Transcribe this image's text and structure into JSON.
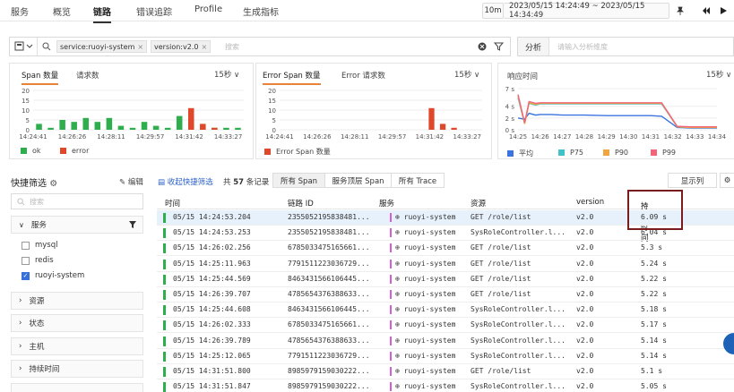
{
  "topnav": {
    "tabs": [
      "服务",
      "概览",
      "链路",
      "错误追踪",
      "Profile",
      "生成指标"
    ],
    "active_tab": "链路",
    "time_range_short": "10m",
    "time_range": "2023/05/15 14:24:49 ~ 2023/05/15 14:34:49"
  },
  "filter": {
    "chips": [
      "service:ruoyi-system",
      "version:v2.0"
    ],
    "placeholder": "搜索",
    "analysis_label": "分析",
    "analysis_placeholder": "请输入分析维度"
  },
  "panels": {
    "span": {
      "tabs": [
        "Span 数量",
        "请求数"
      ],
      "interval": "15秒 ∨",
      "legend": [
        {
          "label": "ok",
          "color": "#2eae4c"
        },
        {
          "label": "error",
          "color": "#e0482b"
        }
      ]
    },
    "error": {
      "tabs": [
        "Error Span 数量",
        "Error 请求数"
      ],
      "interval": "15秒 ∨",
      "legend": [
        {
          "label": "Error Span 数量",
          "color": "#e0482b"
        }
      ]
    },
    "latency": {
      "title": "响应时间",
      "interval": "15秒 ∨",
      "legend": [
        {
          "label": "平均",
          "color": "#3b73e0"
        },
        {
          "label": "P75",
          "color": "#41c2c9"
        },
        {
          "label": "P90",
          "color": "#f0a63f"
        },
        {
          "label": "P99",
          "color": "#f0657a"
        }
      ]
    }
  },
  "chart_data": [
    {
      "type": "bar",
      "title": "Span 数量",
      "ylim": [
        0,
        20
      ],
      "yticks": [
        "20",
        "15",
        "10",
        "5",
        "0"
      ],
      "xticks": [
        "14:24:41",
        "14:26:26",
        "14:28:11",
        "14:29:57",
        "14:31:42",
        "14:33:27"
      ],
      "series": [
        {
          "name": "ok",
          "values": [
            3,
            1,
            5,
            4,
            6,
            4,
            6,
            2,
            1,
            4,
            2,
            1,
            7,
            3,
            1,
            1,
            1,
            1
          ]
        },
        {
          "name": "error",
          "values": [
            0,
            0,
            0,
            0,
            0,
            0,
            0,
            0,
            0,
            0,
            0,
            0,
            0,
            11,
            3,
            1,
            0,
            0
          ]
        }
      ]
    },
    {
      "type": "bar",
      "title": "Error Span 数量",
      "ylim": [
        0,
        20
      ],
      "yticks": [
        "20",
        "15",
        "10",
        "5",
        "0"
      ],
      "xticks": [
        "14:24:41",
        "14:26:26",
        "14:28:11",
        "14:29:57",
        "14:31:42",
        "14:33:27"
      ],
      "series": [
        {
          "name": "Error Span 数量",
          "values": [
            0,
            0,
            0,
            0,
            0,
            0,
            0,
            0,
            0,
            0,
            0,
            0,
            0,
            11,
            3,
            1,
            0,
            0
          ]
        }
      ]
    },
    {
      "type": "line",
      "title": "响应时间",
      "ylim": [
        0,
        7
      ],
      "yticks": [
        "7 s",
        "4 s",
        "2 s",
        "0 s"
      ],
      "xticks": [
        "14:25",
        "14:26",
        "14:27",
        "14:28",
        "14:29",
        "14:30",
        "14:31",
        "14:32",
        "14:33",
        "14:34"
      ],
      "x": [
        0,
        0.3,
        0.5,
        0.8,
        1.0,
        1.5,
        2,
        3,
        4,
        5,
        6,
        6.5,
        7.2,
        7.8,
        8.5,
        9
      ],
      "series": [
        {
          "name": "平均",
          "values": [
            2.0,
            1.8,
            2.8,
            2.5,
            2.6,
            2.6,
            2.5,
            2.5,
            2.4,
            2.4,
            2.4,
            2.3,
            0.4,
            0.3,
            0.3,
            0.3
          ]
        },
        {
          "name": "P75",
          "values": [
            5.5,
            1.0,
            4.5,
            4.2,
            4.4,
            4.4,
            4.4,
            4.4,
            4.4,
            4.4,
            4.4,
            4.4,
            0.5,
            0.4,
            0.4,
            0.4
          ]
        },
        {
          "name": "P90",
          "values": [
            5.8,
            1.0,
            4.6,
            4.3,
            4.5,
            4.5,
            4.5,
            4.5,
            4.5,
            4.5,
            4.5,
            4.5,
            0.5,
            0.4,
            0.4,
            0.4
          ]
        },
        {
          "name": "P99",
          "values": [
            6.0,
            1.2,
            4.8,
            4.5,
            4.6,
            4.6,
            4.6,
            4.6,
            4.6,
            4.6,
            4.6,
            4.6,
            0.6,
            0.5,
            0.5,
            0.5
          ]
        }
      ]
    }
  ],
  "quickfilter": {
    "title": "快捷筛选",
    "edit": "编辑",
    "search_placeholder": "搜索",
    "service_group": "服务",
    "service_items": [
      {
        "label": "mysql",
        "checked": false
      },
      {
        "label": "redis",
        "checked": false
      },
      {
        "label": "ruoyi-system",
        "checked": true
      }
    ],
    "groups": [
      "资源",
      "状态",
      "主机",
      "持续时间"
    ]
  },
  "toolbar": {
    "collect": "收起快捷筛选",
    "count_prefix": "共",
    "count": "57",
    "count_suffix": "条记录",
    "views": [
      "所有 Span",
      "服务顶层 Span",
      "所有 Trace"
    ],
    "display_cols": "显示列"
  },
  "table": {
    "headers": [
      "时间",
      "链路 ID",
      "服务",
      "资源",
      "version",
      "持续时间"
    ],
    "rows": [
      {
        "time": "05/15 14:24:53.204",
        "trace": "2355052195838481...",
        "service": "ruoyi-system",
        "resource": "GET /role/list",
        "version": "v2.0",
        "duration": "6.09 s"
      },
      {
        "time": "05/15 14:24:53.253",
        "trace": "2355052195838481...",
        "service": "ruoyi-system",
        "resource": "SysRoleController.l...",
        "version": "v2.0",
        "duration": "6.04 s"
      },
      {
        "time": "05/15 14:26:02.256",
        "trace": "6785033475165661...",
        "service": "ruoyi-system",
        "resource": "GET /role/list",
        "version": "v2.0",
        "duration": "5.3 s"
      },
      {
        "time": "05/15 14:25:11.963",
        "trace": "7791511223036729...",
        "service": "ruoyi-system",
        "resource": "GET /role/list",
        "version": "v2.0",
        "duration": "5.24 s"
      },
      {
        "time": "05/15 14:25:44.569",
        "trace": "8463431566106445...",
        "service": "ruoyi-system",
        "resource": "GET /role/list",
        "version": "v2.0",
        "duration": "5.22 s"
      },
      {
        "time": "05/15 14:26:39.707",
        "trace": "4785654376388633...",
        "service": "ruoyi-system",
        "resource": "GET /role/list",
        "version": "v2.0",
        "duration": "5.22 s"
      },
      {
        "time": "05/15 14:25:44.608",
        "trace": "8463431566106445...",
        "service": "ruoyi-system",
        "resource": "SysRoleController.l...",
        "version": "v2.0",
        "duration": "5.18 s"
      },
      {
        "time": "05/15 14:26:02.333",
        "trace": "6785033475165661...",
        "service": "ruoyi-system",
        "resource": "SysRoleController.l...",
        "version": "v2.0",
        "duration": "5.17 s"
      },
      {
        "time": "05/15 14:26:39.789",
        "trace": "4785654376388633...",
        "service": "ruoyi-system",
        "resource": "SysRoleController.l...",
        "version": "v2.0",
        "duration": "5.14 s"
      },
      {
        "time": "05/15 14:25:12.065",
        "trace": "7791511223036729...",
        "service": "ruoyi-system",
        "resource": "SysRoleController.l...",
        "version": "v2.0",
        "duration": "5.14 s"
      },
      {
        "time": "05/15 14:31:51.800",
        "trace": "8985979159030222...",
        "service": "ruoyi-system",
        "resource": "GET /role/list",
        "version": "v2.0",
        "duration": "5.1 s"
      },
      {
        "time": "05/15 14:31:51.847",
        "trace": "8985979159030222...",
        "service": "ruoyi-system",
        "resource": "SysRoleController.l...",
        "version": "v2.0",
        "duration": "5.05 s"
      }
    ]
  }
}
